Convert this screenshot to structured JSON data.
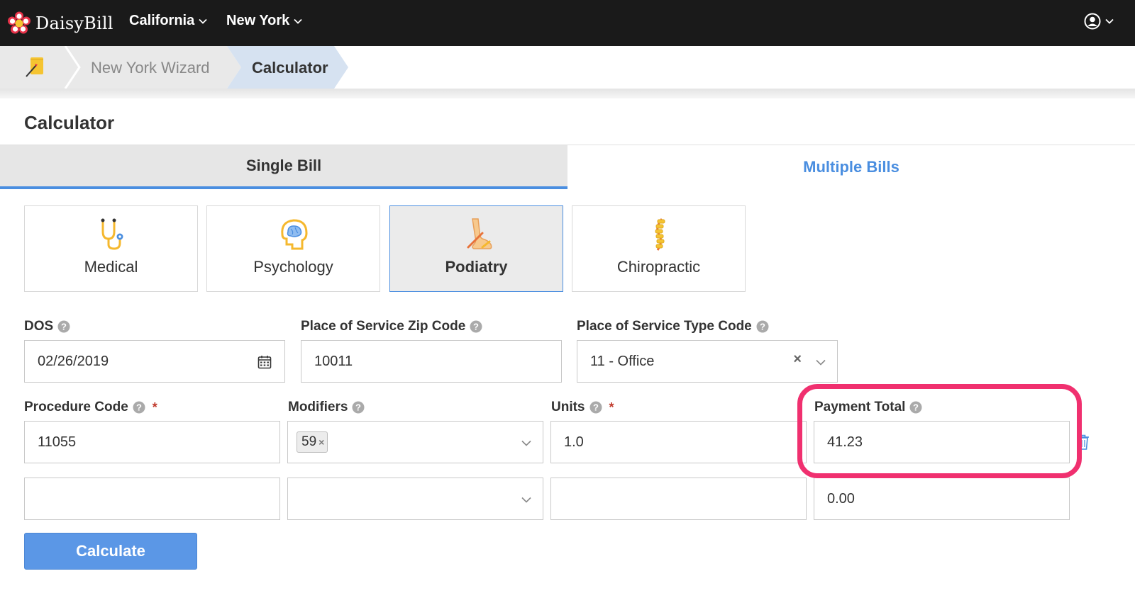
{
  "brand": {
    "name": "DaisyBill",
    "logo_icon": "daisy-flower-icon"
  },
  "nav": {
    "items": [
      {
        "label": "California"
      },
      {
        "label": "New York"
      }
    ],
    "user_icon": "user-circle-icon"
  },
  "breadcrumb": {
    "home_icon": "wizard-note-icon",
    "items": [
      {
        "label": "New York Wizard"
      },
      {
        "label": "Calculator"
      }
    ]
  },
  "page": {
    "title": "Calculator"
  },
  "tabs": [
    {
      "label": "Single Bill",
      "active": true
    },
    {
      "label": "Multiple Bills",
      "active": false
    }
  ],
  "provider_types": [
    {
      "label": "Medical",
      "icon": "stethoscope-icon",
      "active": false
    },
    {
      "label": "Psychology",
      "icon": "brain-icon",
      "active": false
    },
    {
      "label": "Podiatry",
      "icon": "foot-icon",
      "active": true
    },
    {
      "label": "Chiropractic",
      "icon": "spine-icon",
      "active": false
    }
  ],
  "form": {
    "dos": {
      "label": "DOS",
      "value": "02/26/2019",
      "icon": "calendar-icon"
    },
    "zip": {
      "label": "Place of Service Zip Code",
      "value": "10011"
    },
    "pos_type": {
      "label": "Place of Service Type Code",
      "value": "11 - Office",
      "clear_symbol": "×"
    },
    "columns": {
      "procedure_code": "Procedure Code",
      "modifiers": "Modifiers",
      "units": "Units",
      "payment_total": "Payment Total",
      "required_mark": "*"
    },
    "rows": [
      {
        "procedure_code": "11055",
        "modifiers": [
          "59"
        ],
        "units": "1.0",
        "payment_total": "41.23"
      },
      {
        "procedure_code": "",
        "modifiers": [],
        "units": "",
        "payment_total": "0.00"
      }
    ],
    "tag_remove_symbol": "×",
    "calculate_label": "Calculate"
  },
  "colors": {
    "navbar_bg": "#1a1a1a",
    "accent_blue": "#4a8ee0",
    "button_blue": "#5b97e6",
    "highlight_pink": "#f0306f",
    "required_red": "#c0392b",
    "breadcrumb_gray": "#e9e9e9",
    "breadcrumb_active": "#d6e2f1"
  }
}
